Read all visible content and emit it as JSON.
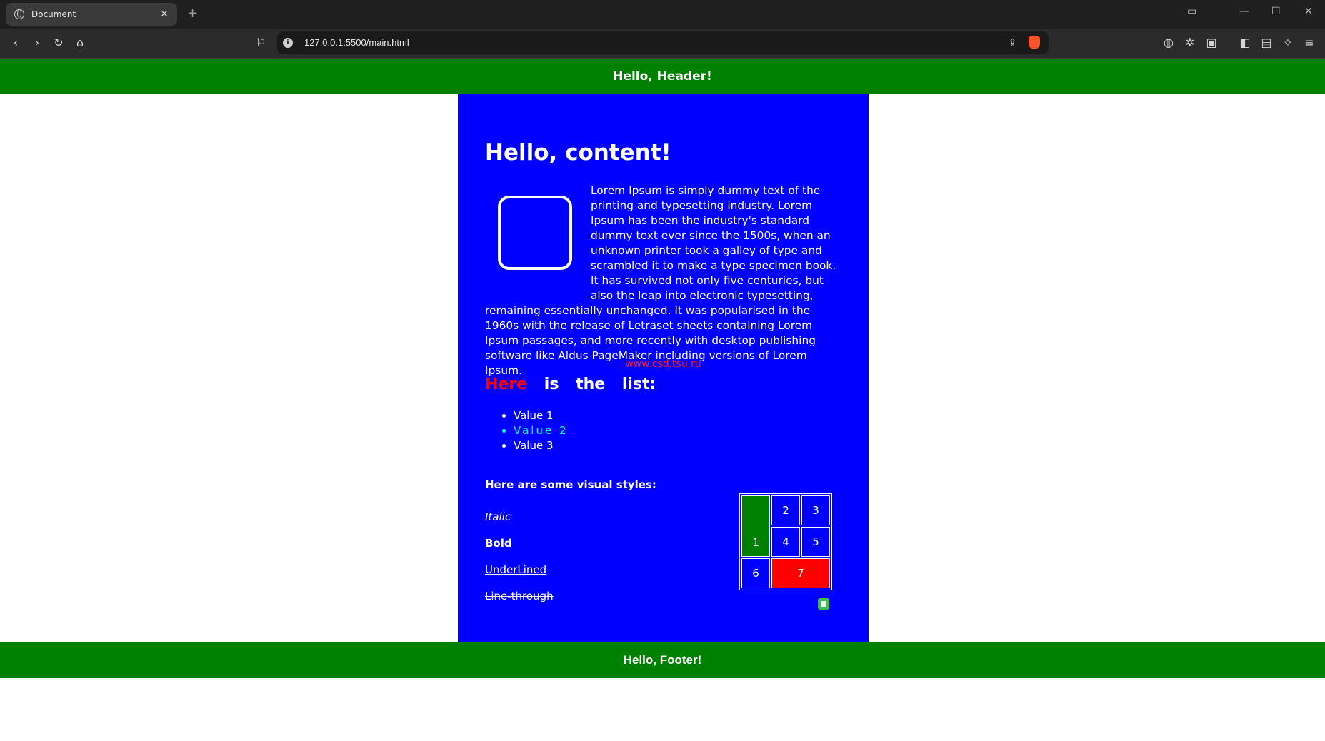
{
  "browser": {
    "tab_title": "Document",
    "tab_close": "✕",
    "new_tab": "+",
    "url": "127.0.0.1:5500/main.html"
  },
  "page": {
    "header": "Hello, Header!",
    "footer": "Hello, Footer!",
    "content_title": "Hello, content!",
    "lorem": "Lorem Ipsum is simply dummy text of the printing and typesetting industry. Lorem Ipsum has been the industry's standard dummy text ever since the 1500s, when an unknown printer took a galley of type and scrambled it to make a type specimen book. It has survived not only five centuries, but also the leap into electronic typesetting, remaining essentially unchanged. It was popularised in the 1960s with the release of Letraset sheets containing Lorem Ipsum passages, and more recently with desktop publishing software like Aldus PageMaker including versions of Lorem Ipsum.",
    "link": "www.csd.tsu.ru",
    "list_heading": {
      "highlight": "Here",
      "rest": "is the list:"
    },
    "list_items": [
      "Value 1",
      "Value 2",
      "Value 3"
    ],
    "styles_title": "Here are some visual styles:",
    "styles": {
      "italic": "Italic",
      "bold": "Bold",
      "underlined": "UnderLined",
      "strike": "Line-through"
    },
    "table_cells": [
      "1",
      "2",
      "3",
      "4",
      "5",
      "6",
      "7"
    ]
  },
  "colors": {
    "header_bg": "#008000",
    "content_bg": "#0000ff",
    "accent_red": "#ff0000",
    "list_cyan": "#00ffff"
  }
}
